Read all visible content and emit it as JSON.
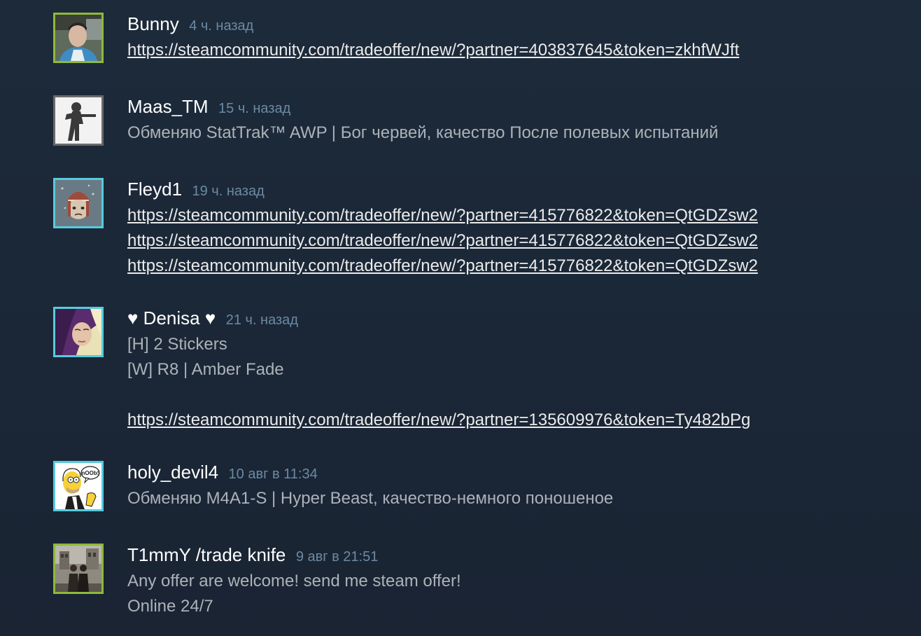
{
  "comments": [
    {
      "author": "Bunny",
      "time": "4 ч. назад",
      "avatar_icon": "avatar-photo-man",
      "status": "ingame",
      "lines": [
        {
          "text": "https://steamcommunity.com/tradeoffer/new/?partner=403837645&token=zkhfWJft",
          "link": true
        }
      ]
    },
    {
      "author": "Maas_TM",
      "time": "15 ч. назад",
      "avatar_icon": "avatar-soldier-silhouette",
      "status": "offline",
      "lines": [
        {
          "text": "Обменяю StatTrak™ AWP | Бог червей, качество После полевых испытаний",
          "link": false
        }
      ]
    },
    {
      "author": "Fleyd1",
      "time": "19 ч. назад",
      "avatar_icon": "avatar-grumpy-cat",
      "status": "online",
      "lines": [
        {
          "text": "https://steamcommunity.com/tradeoffer/new/?partner=415776822&token=QtGDZsw2",
          "link": true
        },
        {
          "text": "https://steamcommunity.com/tradeoffer/new/?partner=415776822&token=QtGDZsw2",
          "link": true
        },
        {
          "text": "https://steamcommunity.com/tradeoffer/new/?partner=415776822&token=QtGDZsw2",
          "link": true
        }
      ]
    },
    {
      "author": "♥ Denisa ♥",
      "time": "21 ч. назад",
      "avatar_icon": "avatar-photo-girl",
      "status": "online",
      "lines": [
        {
          "text": "[H] 2 Stickers",
          "link": false
        },
        {
          "text": "[W] R8 | Amber Fade",
          "link": false
        },
        {
          "text": "",
          "link": false
        },
        {
          "text": "https://steamcommunity.com/tradeoffer/new/?partner=135609976&token=Ty482bPg",
          "link": true
        }
      ]
    },
    {
      "author": "holy_devil4",
      "time": "10 авг в 11:34",
      "avatar_icon": "avatar-homer-cartoon",
      "avatar_caption": "nOOb!",
      "status": "online",
      "lines": [
        {
          "text": "Обменяю M4A1-S | Hyper Beast, качество-немного поношеное",
          "link": false
        }
      ]
    },
    {
      "author": "T1mmY /trade knife",
      "time": "9 авг в 21:51",
      "avatar_icon": "avatar-photo-couple",
      "status": "ingame",
      "lines": [
        {
          "text": "Any offer are welcome! send me steam offer!",
          "link": false
        },
        {
          "text": "Online 24/7",
          "link": false
        }
      ]
    }
  ]
}
